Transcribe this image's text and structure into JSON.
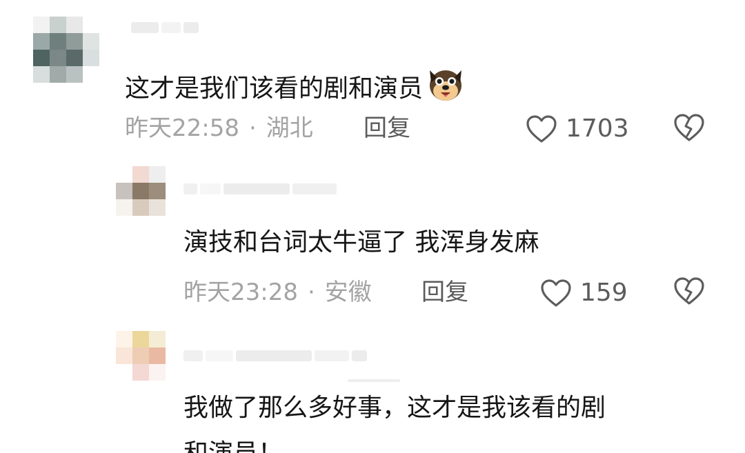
{
  "comments": [
    {
      "text": "这才是我们该看的剧和演员",
      "time": "昨天22:58",
      "separator": "·",
      "location": "湖北",
      "reply_label": "回复",
      "likes": "1703",
      "emoji": "dog-face-emoji"
    },
    {
      "text": "演技和台词太牛逼了 我浑身发麻",
      "time": "昨天23:28",
      "separator": "·",
      "location": "安徽",
      "reply_label": "回复",
      "likes": "159"
    },
    {
      "text": "我做了那么多好事，这才是我该看的剧",
      "text_continued": "和演员！"
    }
  ],
  "icons": {
    "like": "heart-outline-icon",
    "dislike": "broken-heart-icon"
  },
  "colors": {
    "text": "#161616",
    "meta": "#a3a3a3",
    "reply": "#5a5a5a",
    "icon": "#5c5c5c"
  }
}
